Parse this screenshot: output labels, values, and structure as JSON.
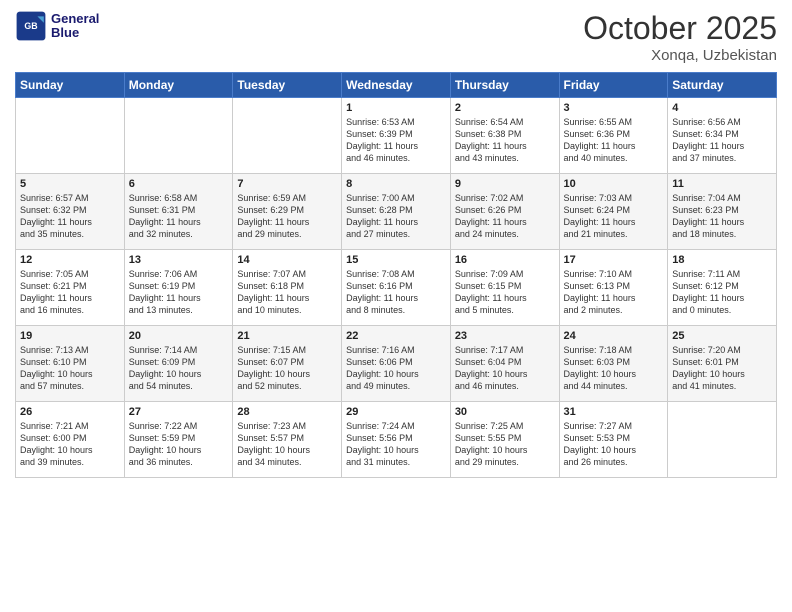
{
  "header": {
    "logo_line1": "General",
    "logo_line2": "Blue",
    "month": "October 2025",
    "location": "Xonqa, Uzbekistan"
  },
  "days_of_week": [
    "Sunday",
    "Monday",
    "Tuesday",
    "Wednesday",
    "Thursday",
    "Friday",
    "Saturday"
  ],
  "weeks": [
    [
      {
        "day": "",
        "text": ""
      },
      {
        "day": "",
        "text": ""
      },
      {
        "day": "",
        "text": ""
      },
      {
        "day": "1",
        "text": "Sunrise: 6:53 AM\nSunset: 6:39 PM\nDaylight: 11 hours\nand 46 minutes."
      },
      {
        "day": "2",
        "text": "Sunrise: 6:54 AM\nSunset: 6:38 PM\nDaylight: 11 hours\nand 43 minutes."
      },
      {
        "day": "3",
        "text": "Sunrise: 6:55 AM\nSunset: 6:36 PM\nDaylight: 11 hours\nand 40 minutes."
      },
      {
        "day": "4",
        "text": "Sunrise: 6:56 AM\nSunset: 6:34 PM\nDaylight: 11 hours\nand 37 minutes."
      }
    ],
    [
      {
        "day": "5",
        "text": "Sunrise: 6:57 AM\nSunset: 6:32 PM\nDaylight: 11 hours\nand 35 minutes."
      },
      {
        "day": "6",
        "text": "Sunrise: 6:58 AM\nSunset: 6:31 PM\nDaylight: 11 hours\nand 32 minutes."
      },
      {
        "day": "7",
        "text": "Sunrise: 6:59 AM\nSunset: 6:29 PM\nDaylight: 11 hours\nand 29 minutes."
      },
      {
        "day": "8",
        "text": "Sunrise: 7:00 AM\nSunset: 6:28 PM\nDaylight: 11 hours\nand 27 minutes."
      },
      {
        "day": "9",
        "text": "Sunrise: 7:02 AM\nSunset: 6:26 PM\nDaylight: 11 hours\nand 24 minutes."
      },
      {
        "day": "10",
        "text": "Sunrise: 7:03 AM\nSunset: 6:24 PM\nDaylight: 11 hours\nand 21 minutes."
      },
      {
        "day": "11",
        "text": "Sunrise: 7:04 AM\nSunset: 6:23 PM\nDaylight: 11 hours\nand 18 minutes."
      }
    ],
    [
      {
        "day": "12",
        "text": "Sunrise: 7:05 AM\nSunset: 6:21 PM\nDaylight: 11 hours\nand 16 minutes."
      },
      {
        "day": "13",
        "text": "Sunrise: 7:06 AM\nSunset: 6:19 PM\nDaylight: 11 hours\nand 13 minutes."
      },
      {
        "day": "14",
        "text": "Sunrise: 7:07 AM\nSunset: 6:18 PM\nDaylight: 11 hours\nand 10 minutes."
      },
      {
        "day": "15",
        "text": "Sunrise: 7:08 AM\nSunset: 6:16 PM\nDaylight: 11 hours\nand 8 minutes."
      },
      {
        "day": "16",
        "text": "Sunrise: 7:09 AM\nSunset: 6:15 PM\nDaylight: 11 hours\nand 5 minutes."
      },
      {
        "day": "17",
        "text": "Sunrise: 7:10 AM\nSunset: 6:13 PM\nDaylight: 11 hours\nand 2 minutes."
      },
      {
        "day": "18",
        "text": "Sunrise: 7:11 AM\nSunset: 6:12 PM\nDaylight: 11 hours\nand 0 minutes."
      }
    ],
    [
      {
        "day": "19",
        "text": "Sunrise: 7:13 AM\nSunset: 6:10 PM\nDaylight: 10 hours\nand 57 minutes."
      },
      {
        "day": "20",
        "text": "Sunrise: 7:14 AM\nSunset: 6:09 PM\nDaylight: 10 hours\nand 54 minutes."
      },
      {
        "day": "21",
        "text": "Sunrise: 7:15 AM\nSunset: 6:07 PM\nDaylight: 10 hours\nand 52 minutes."
      },
      {
        "day": "22",
        "text": "Sunrise: 7:16 AM\nSunset: 6:06 PM\nDaylight: 10 hours\nand 49 minutes."
      },
      {
        "day": "23",
        "text": "Sunrise: 7:17 AM\nSunset: 6:04 PM\nDaylight: 10 hours\nand 46 minutes."
      },
      {
        "day": "24",
        "text": "Sunrise: 7:18 AM\nSunset: 6:03 PM\nDaylight: 10 hours\nand 44 minutes."
      },
      {
        "day": "25",
        "text": "Sunrise: 7:20 AM\nSunset: 6:01 PM\nDaylight: 10 hours\nand 41 minutes."
      }
    ],
    [
      {
        "day": "26",
        "text": "Sunrise: 7:21 AM\nSunset: 6:00 PM\nDaylight: 10 hours\nand 39 minutes."
      },
      {
        "day": "27",
        "text": "Sunrise: 7:22 AM\nSunset: 5:59 PM\nDaylight: 10 hours\nand 36 minutes."
      },
      {
        "day": "28",
        "text": "Sunrise: 7:23 AM\nSunset: 5:57 PM\nDaylight: 10 hours\nand 34 minutes."
      },
      {
        "day": "29",
        "text": "Sunrise: 7:24 AM\nSunset: 5:56 PM\nDaylight: 10 hours\nand 31 minutes."
      },
      {
        "day": "30",
        "text": "Sunrise: 7:25 AM\nSunset: 5:55 PM\nDaylight: 10 hours\nand 29 minutes."
      },
      {
        "day": "31",
        "text": "Sunrise: 7:27 AM\nSunset: 5:53 PM\nDaylight: 10 hours\nand 26 minutes."
      },
      {
        "day": "",
        "text": ""
      }
    ]
  ]
}
